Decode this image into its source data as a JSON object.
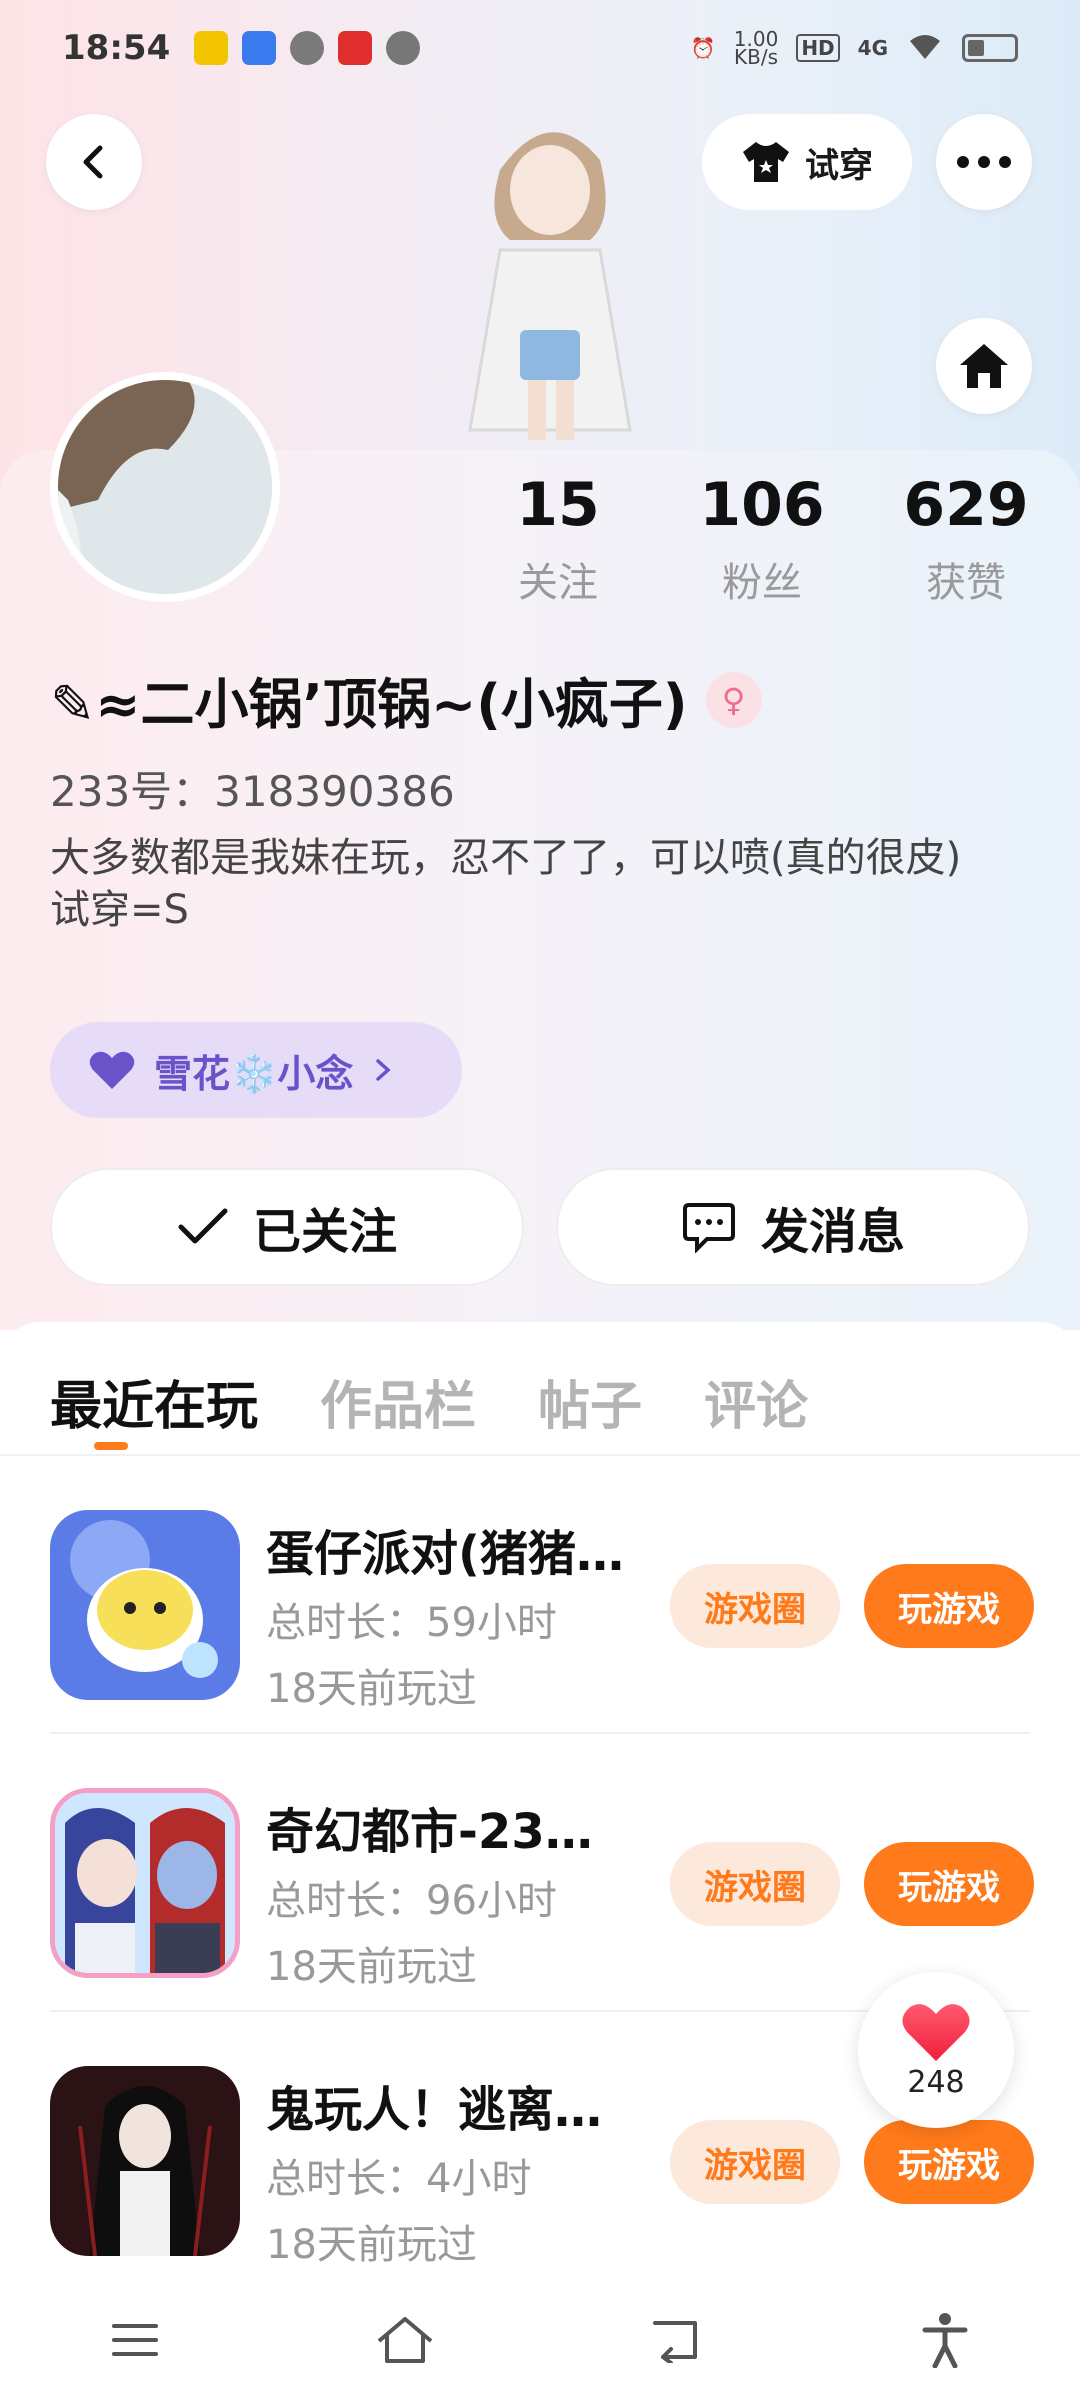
{
  "status_bar": {
    "time": "18:54",
    "network_speed": "1.00\nKB/s",
    "network_speed_value": "1.00",
    "network_speed_unit": "KB/s",
    "hd_label": "HD",
    "signal_label": "4G"
  },
  "header": {
    "try_on_label": "试穿"
  },
  "stats": [
    {
      "value": "15",
      "label": "关注"
    },
    {
      "value": "106",
      "label": "粉丝"
    },
    {
      "value": "629",
      "label": "获赞"
    }
  ],
  "profile": {
    "nickname": "✎≈二小锅’顶锅~(小疯子)",
    "gender_symbol": "♀",
    "user_id": "233号：318390386",
    "bio_line1": "大多数都是我妹在玩，忍不了了，可以喷(真的很皮)",
    "bio_line2": "试穿=S",
    "fan_badge": "雪花❄️小念",
    "colors": {
      "accent": "#ff7a1a",
      "badge_bg": "#e6dcf8",
      "badge_text": "#6a52c9",
      "gender": "#ef6d8c"
    }
  },
  "actions": {
    "followed_label": "已关注",
    "message_label": "发消息"
  },
  "tabs": [
    {
      "label": "最近在玩",
      "active": true
    },
    {
      "label": "作品栏",
      "active": false
    },
    {
      "label": "帖子",
      "active": false
    },
    {
      "label": "评论",
      "active": false
    }
  ],
  "games": [
    {
      "title": "蛋仔派对(猪猪…",
      "duration": "总时长：59小时",
      "last_played": "18天前玩过",
      "circle_label": "游戏圈",
      "play_label": "玩游戏",
      "icon": "eggy-party-icon"
    },
    {
      "title": "奇幻都市-23…",
      "duration": "总时长：96小时",
      "last_played": "18天前玩过",
      "circle_label": "游戏圈",
      "play_label": "玩游戏",
      "icon": "fantasy-city-icon"
    },
    {
      "title": "鬼玩人！逃离…",
      "duration": "总时长：4小时",
      "last_played": "18天前玩过",
      "circle_label": "游戏圈",
      "play_label": "玩游戏",
      "icon": "ghost-game-icon"
    }
  ],
  "like_float": {
    "count": "248"
  }
}
